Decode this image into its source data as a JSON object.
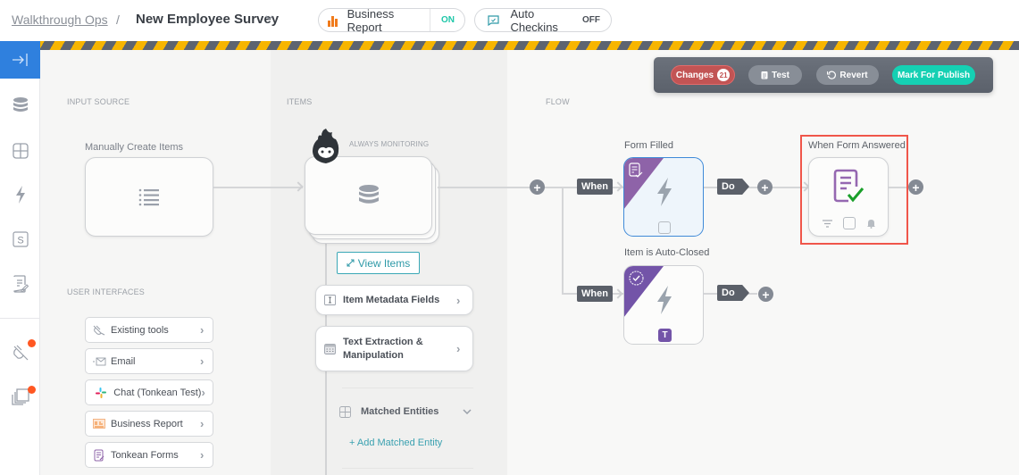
{
  "header": {
    "breadcrumb_root": "Walkthrough Ops",
    "breadcrumb_separator": "/",
    "title": "New Employee Survey",
    "title_caret": "⌄",
    "business_report": {
      "label": "Business Report",
      "state": "ON"
    },
    "auto_checkins": {
      "label": "Auto Checkins",
      "state": "OFF"
    }
  },
  "sidebar": {
    "collapse_icon": "→|",
    "items": [
      {
        "name": "database-icon"
      },
      {
        "name": "grid-icon"
      },
      {
        "name": "lightning-icon"
      },
      {
        "name": "s-box-icon",
        "glyph": "S"
      },
      {
        "name": "form-edit-icon"
      },
      {
        "name": "plug-icon",
        "notification": true
      },
      {
        "name": "layers-icon",
        "notification": true
      }
    ]
  },
  "toolbar": {
    "changes_label": "Changes",
    "changes_count": "21",
    "test_label": "Test",
    "revert_label": "Revert",
    "publish_label": "Mark For Publish",
    "colors": {
      "changes": "#c25454",
      "publish": "#15d0b3",
      "neutral": "#888e97"
    }
  },
  "input_source": {
    "section_label": "INPUT SOURCE",
    "node_title": "Manually Create Items"
  },
  "user_interfaces": {
    "section_label": "USER INTERFACES",
    "items": [
      {
        "label": "Existing tools",
        "icon": "plug-icon"
      },
      {
        "label": "Email",
        "icon": "email-icon"
      },
      {
        "label": "Chat (Tonkean Test)",
        "icon": "slack-icon"
      },
      {
        "label": "Business Report",
        "icon": "report-icon"
      },
      {
        "label": "Tonkean Forms",
        "icon": "form-icon"
      }
    ]
  },
  "items": {
    "section_label": "ITEMS",
    "monitoring_label": "ALWAYS MONITORING",
    "view_items_label": "View Items",
    "metadata_label": "Item Metadata Fields",
    "text_extraction_label": "Text Extraction & Manipulation",
    "matched_entities_label": "Matched Entities",
    "add_matched_entity_label": "+ Add Matched Entity"
  },
  "flow": {
    "section_label": "FLOW",
    "when_label": "When",
    "do_label": "Do",
    "plus_glyph": "+",
    "triggers": [
      {
        "title": "Form Filled",
        "selected": true
      },
      {
        "title": "Item is Auto-Closed",
        "badge": "T"
      }
    ],
    "action": {
      "title": "When Form Answered",
      "highlighted": true
    },
    "colors": {
      "trigger_corner": "#8e63a8",
      "auto_closed_corner": "#7354a8",
      "check": "#1a9f2a",
      "highlight": "#f0564a"
    }
  }
}
